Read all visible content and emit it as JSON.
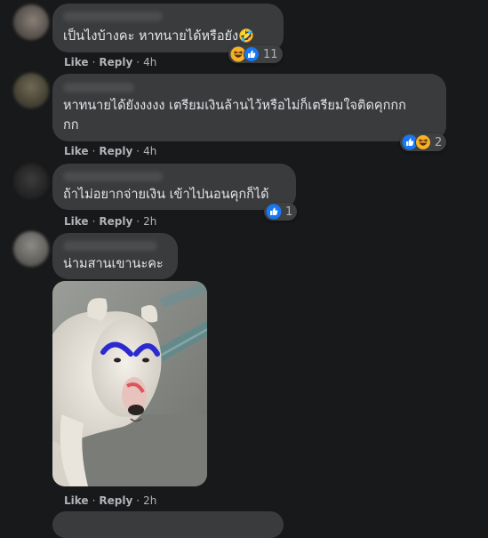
{
  "comments": [
    {
      "text": "เป็นไงบ้างคะ หาทนายได้หรือยัง🤣",
      "like_label": "Like",
      "reply_label": "Reply",
      "time": "4h",
      "reaction_count": "11",
      "reactions": [
        "haha-icon",
        "like-icon"
      ]
    },
    {
      "text_line1": "หาทนายได้ยังงงงง เตรียมเงินล้านไว้หรือไม่ก็เตรียมใจติดคุกกก",
      "text_line2": "กก",
      "like_label": "Like",
      "reply_label": "Reply",
      "time": "4h",
      "reaction_count": "2",
      "reactions": [
        "like-icon",
        "haha-icon"
      ]
    },
    {
      "text": "ถ้าไม่อยากจ่ายเงิน เข้าไปนอนคุกก็ได้",
      "like_label": "Like",
      "reply_label": "Reply",
      "time": "2h",
      "reaction_count": "1",
      "reactions": [
        "like-icon"
      ]
    },
    {
      "text": "น่ามสานเขานะคะ",
      "like_label": "Like",
      "reply_label": "Reply",
      "time": "2h",
      "attachment": "photo-of-white-dog-with-painted-eyebrows"
    }
  ],
  "colors": {
    "background": "#18191a",
    "bubble": "#3a3b3c",
    "text": "#e4e6eb",
    "secondary": "#b0b3b8",
    "like_blue": "#1877f2",
    "haha_yellow": "#f7b125"
  }
}
